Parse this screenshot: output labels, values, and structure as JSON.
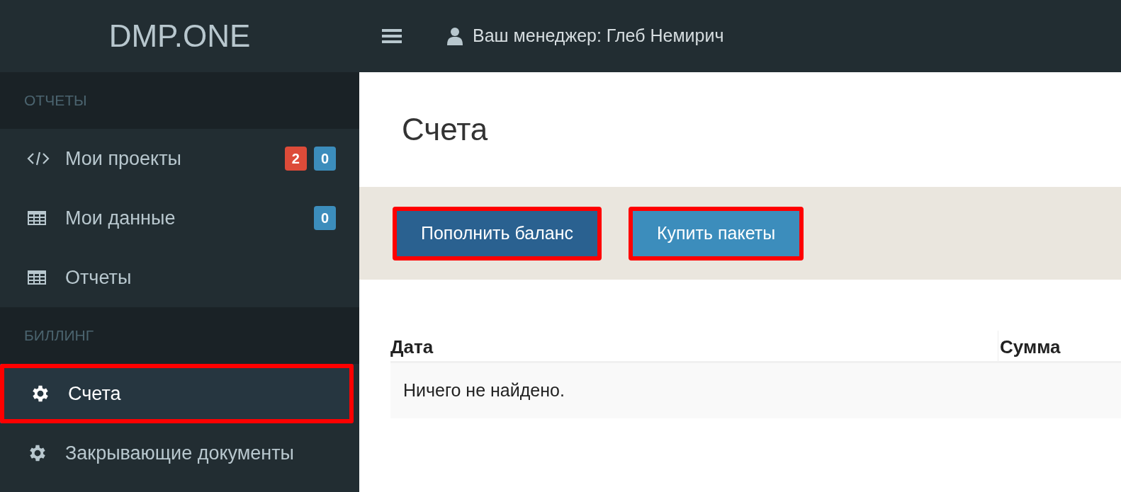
{
  "header": {
    "logo": "DMP.ONE",
    "manager": "Ваш менеджер: Глеб Немирич"
  },
  "sidebar": {
    "sections": [
      {
        "title": "ОТЧЕТЫ",
        "items": [
          {
            "label": "Мои проекты",
            "selected": false,
            "highlighted": false,
            "badges": [
              {
                "text": "2",
                "color": "#dd4b39"
              },
              {
                "text": "0",
                "color": "#3c8dbc"
              }
            ]
          },
          {
            "label": "Мои данные",
            "selected": false,
            "highlighted": false,
            "badges": [
              {
                "text": "0",
                "color": "#3c8dbc"
              }
            ]
          },
          {
            "label": "Отчеты",
            "selected": false,
            "highlighted": false
          }
        ]
      },
      {
        "title": "БИЛЛИНГ",
        "items": [
          {
            "label": "Счета",
            "selected": true,
            "highlighted": true
          },
          {
            "label": "Закрывающие документы",
            "selected": false,
            "highlighted": false
          }
        ]
      }
    ]
  },
  "page": {
    "title": "Счета",
    "buttons": [
      {
        "label": "Пополнить баланс",
        "kind": "primary",
        "highlighted": true
      },
      {
        "label": "Купить пакеты",
        "kind": "info",
        "highlighted": true
      }
    ],
    "table": {
      "columns": [
        "Дата",
        "Сумма"
      ],
      "empty_text": "Ничего не найдено."
    }
  }
}
